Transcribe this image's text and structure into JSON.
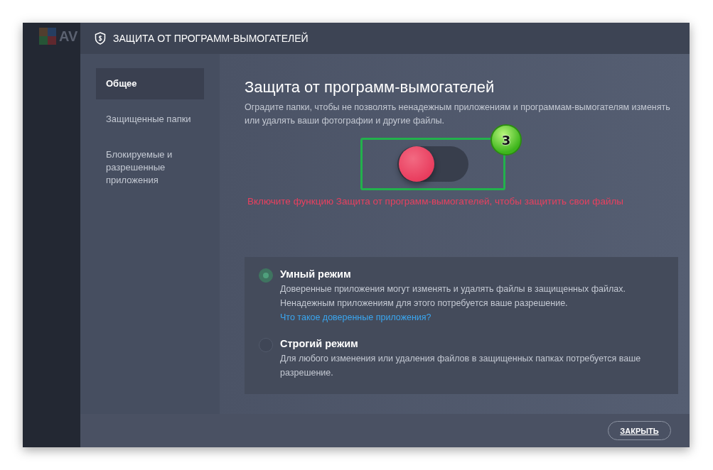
{
  "app": {
    "logo_text": "AV"
  },
  "dialog": {
    "title": "ЗАЩИТА ОТ ПРОГРАММ-ВЫМОГАТЕЛЕЙ"
  },
  "sidebar": {
    "items": [
      {
        "label": "Общее",
        "selected": true
      },
      {
        "label": "Защищенные папки",
        "selected": false
      },
      {
        "label": "Блокируемые и разрешенные приложения",
        "selected": false
      }
    ]
  },
  "content": {
    "heading": "Защита от программ-вымогателей",
    "description": "Оградите папки, чтобы не позволять ненадежным приложениям и программам-вымогателям изменять или удалять ваши фотографии и другие файлы.",
    "toggle": {
      "on": false
    },
    "annotation": {
      "number": "3"
    },
    "warning": "Включите функцию Защита от программ-вымогателей, чтобы защитить свои файлы",
    "modes": [
      {
        "title": "Умный режим",
        "description": "Доверенные приложения могут изменять и удалять файлы в защищенных файлах. Ненадежным приложениям для этого потребуется ваше разрешение.",
        "link": "Что такое доверенные приложения?",
        "selected": true
      },
      {
        "title": "Строгий режим",
        "description": "Для любого изменения или удаления файлов в защищенных папках потребуется ваше разрешение.",
        "selected": false
      }
    ]
  },
  "footer": {
    "close_button": "ЗАКРЫТЬ"
  }
}
